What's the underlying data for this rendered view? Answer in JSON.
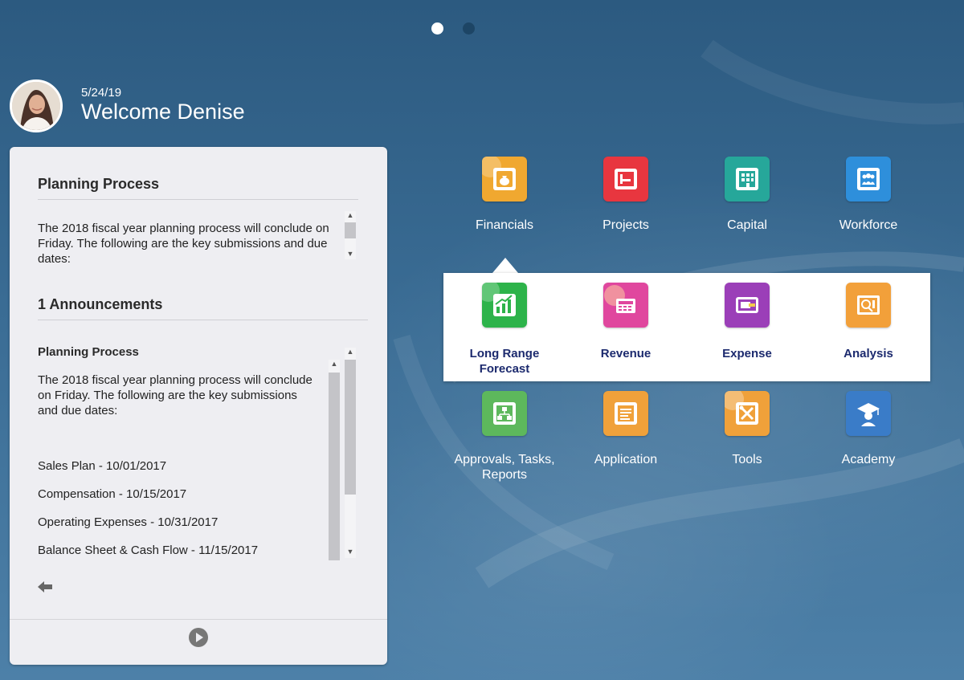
{
  "pager": {
    "pages": 2,
    "active": 0
  },
  "header": {
    "date": "5/24/19",
    "welcome": "Welcome Denise"
  },
  "panel": {
    "planning": {
      "title": "Planning Process",
      "text": "The 2018 fiscal year planning process will conclude on Friday. The following are the key submissions and due dates:"
    },
    "announcements": {
      "title": "1 Announcements",
      "item_title": "Planning Process",
      "item_text": "The 2018 fiscal year planning process will conclude on Friday. The following are the key submissions and due dates:",
      "dates": [
        "Sales Plan - 10/01/2017",
        "Compensation - 10/15/2017",
        "Operating Expenses - 10/31/2017",
        "Balance Sheet & Cash Flow - 11/15/2017"
      ]
    }
  },
  "apps": {
    "row1": [
      {
        "label": "Financials",
        "icon": "money-bag-icon",
        "color": "#f0a830"
      },
      {
        "label": "Projects",
        "icon": "project-folder-icon",
        "color": "#e8363f"
      },
      {
        "label": "Capital",
        "icon": "building-icon",
        "color": "#26a79a"
      },
      {
        "label": "Workforce",
        "icon": "people-icon",
        "color": "#2e8fdb"
      }
    ],
    "sub": [
      {
        "label": "Long Range Forecast",
        "icon": "growth-chart-icon",
        "color": "#2db34a"
      },
      {
        "label": "Revenue",
        "icon": "cash-register-icon",
        "color": "#e0479e"
      },
      {
        "label": "Expense",
        "icon": "wallet-icon",
        "color": "#9b3fb8"
      },
      {
        "label": "Analysis",
        "icon": "analysis-chart-icon",
        "color": "#f2a03a"
      }
    ],
    "row2": [
      {
        "label": "Approvals, Tasks, Reports",
        "icon": "workflow-icon",
        "color": "#5db85c"
      },
      {
        "label": "Application",
        "icon": "application-folders-icon",
        "color": "#f0a13a"
      },
      {
        "label": "Tools",
        "icon": "tools-icon",
        "color": "#f0a13a"
      },
      {
        "label": "Academy",
        "icon": "graduate-icon",
        "color": "#3a7cc8"
      }
    ]
  }
}
